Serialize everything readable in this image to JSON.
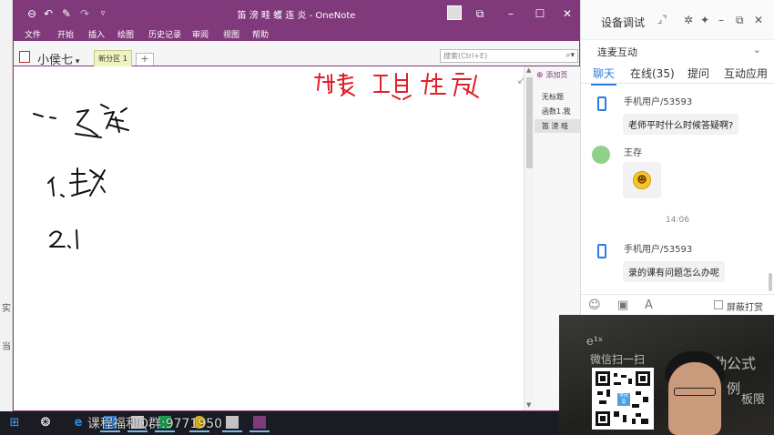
{
  "onenote": {
    "title": "笛 滂 畦 蠖 连 炎 - OneNote",
    "ribbon_tabs": [
      "文件",
      "开始",
      "插入",
      "绘图",
      "历史记录",
      "审阅",
      "视图",
      "帮助"
    ],
    "notebook_name": "小侯七",
    "section_tab": "新分区 1",
    "add_tab": "+",
    "search_placeholder": "搜索(Ctrl+E)",
    "add_page_label": "添加页",
    "pages": [
      "无标题",
      "函数1.我",
      "笛 滂 畦"
    ],
    "ink_colors": {
      "black": "#111111",
      "red": "#e0202a"
    }
  },
  "chat_panel": {
    "title": "设备调试",
    "subheader": "连麦互动",
    "tabs": [
      "聊天",
      "在线(35)",
      "提问",
      "互动应用"
    ],
    "messages": [
      {
        "user": "手机用户/53593",
        "text": "老师平时什么时候答疑啊?"
      },
      {
        "user": "王存",
        "text": ""
      },
      {
        "user": "手机用户/53593",
        "text": "录的课有问题怎么办呢"
      }
    ],
    "time_divider": "14:06",
    "shield_label": "屏蔽打赏",
    "accent_color": "#2b7de1"
  },
  "video": {
    "board_lines": [
      "e¹ˣ",
      "微信扫一扫",
      "勤公式",
      "例",
      "板限"
    ],
    "qr_logo_text": "学而思"
  },
  "taskbar": {
    "watermark": "课程福利Q群:9771950"
  },
  "background": {
    "left_texts": [
      "实",
      "当"
    ]
  }
}
